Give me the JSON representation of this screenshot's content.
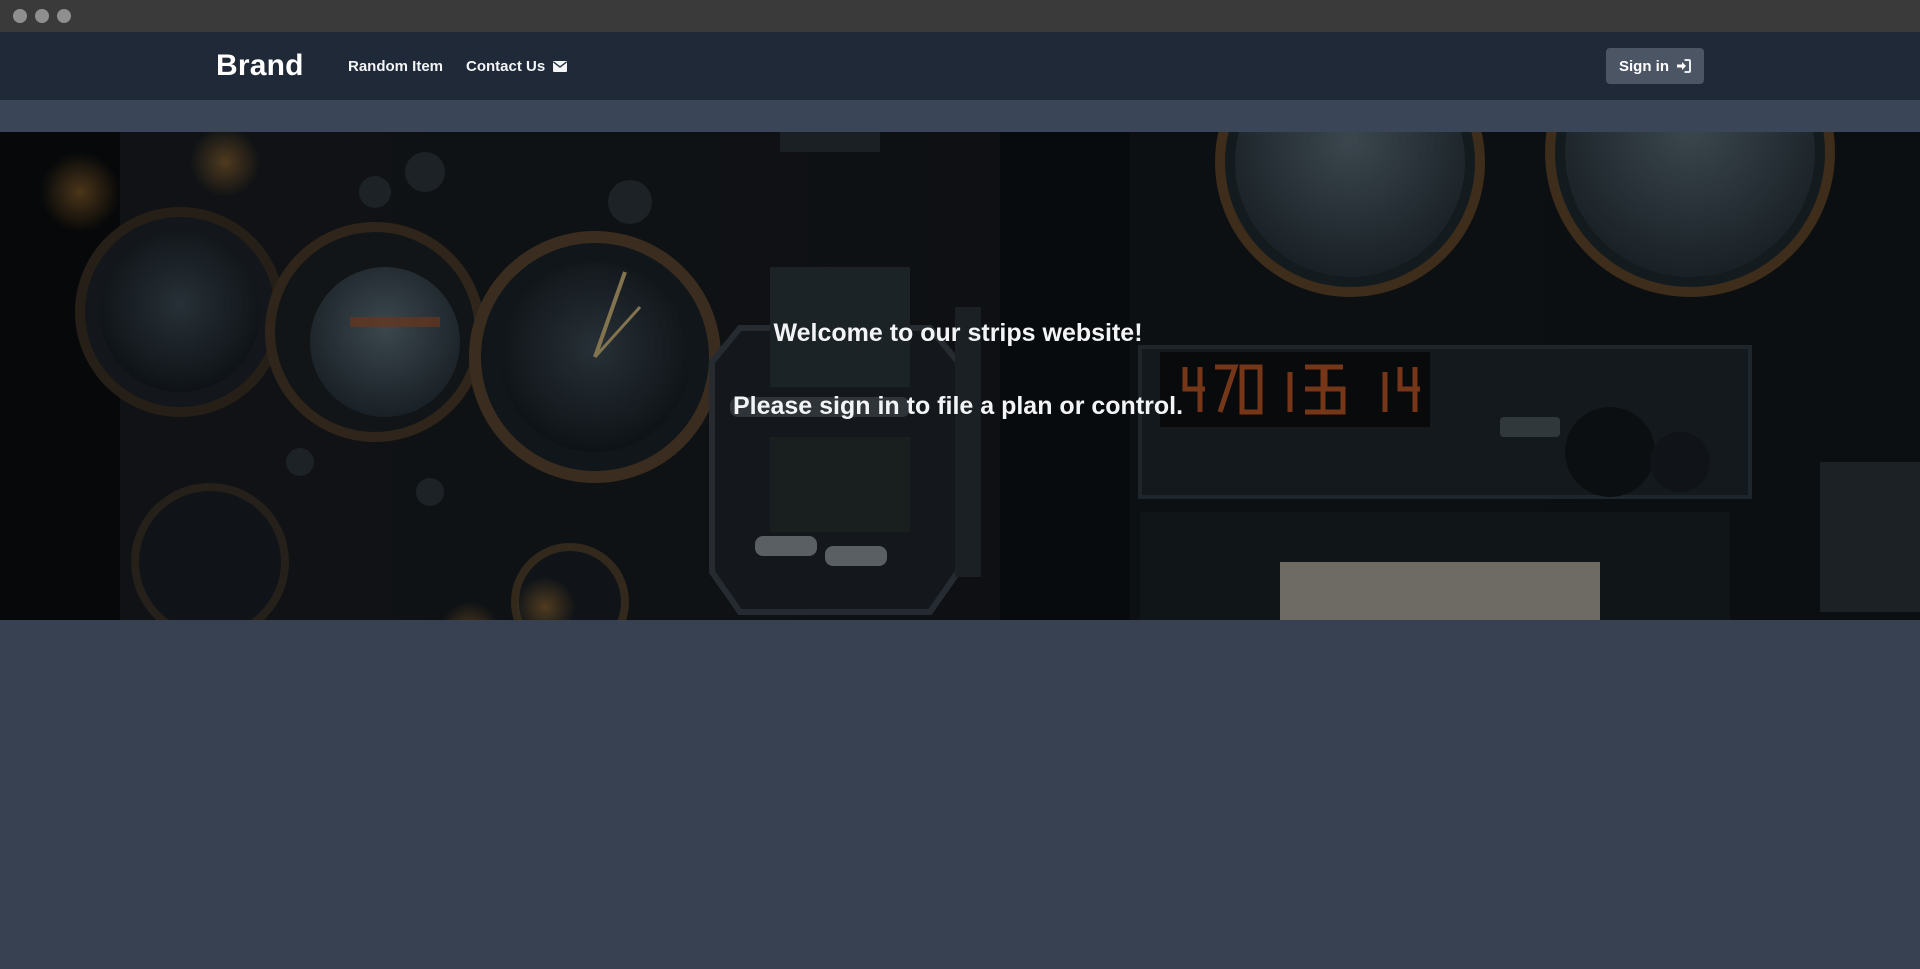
{
  "navbar": {
    "brand": "Brand",
    "links": [
      {
        "label": "Random Item"
      },
      {
        "label": "Contact Us",
        "icon": "envelope-icon"
      }
    ],
    "signin": {
      "label": "Sign in",
      "icon": "sign-in-icon"
    }
  },
  "hero": {
    "welcome": "Welcome to our strips website!",
    "prompt": "Please sign in to file a plan or control.",
    "background": "cockpit instrument panel photo"
  },
  "colors": {
    "navbar": "#1f2937",
    "page": "#374151",
    "signin_button": "#4b5563",
    "display_digits": "#e0642a"
  }
}
